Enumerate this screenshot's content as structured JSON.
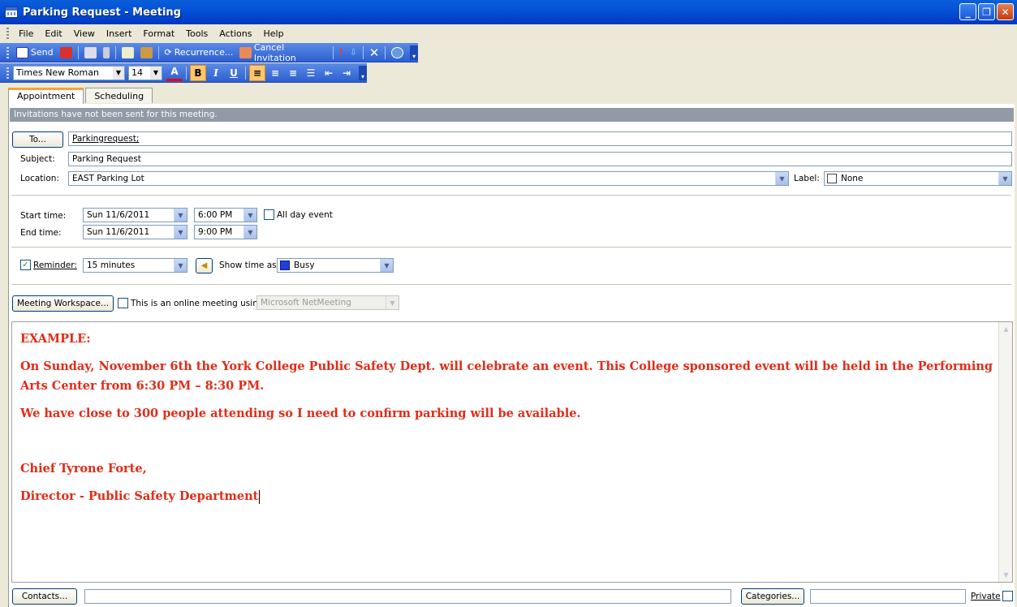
{
  "window": {
    "title": "Parking Request - Meeting"
  },
  "menu": [
    "File",
    "Edit",
    "View",
    "Insert",
    "Format",
    "Tools",
    "Actions",
    "Help"
  ],
  "toolbar": {
    "send": "Send",
    "recurrence": "Recurrence...",
    "cancel_invitation": "Cancel Invitation"
  },
  "format_bar": {
    "font": "Times New Roman",
    "size": "14",
    "bold": "B",
    "italic": "I",
    "underline": "U",
    "font_color": "A"
  },
  "tabs": [
    "Appointment",
    "Scheduling"
  ],
  "info_bar": "Invitations have not been sent for this meeting.",
  "form": {
    "to_button": "To...",
    "to_value": "Parkingrequest;",
    "subject_label": "Subject:",
    "subject_value": "Parking Request",
    "location_label": "Location:",
    "location_value": "EAST Parking Lot",
    "label_label": "Label:",
    "label_value": "None",
    "start_label": "Start time:",
    "start_date": "Sun 11/6/2011",
    "start_time": "6:00 PM",
    "all_day": "All day event",
    "end_label": "End time:",
    "end_date": "Sun 11/6/2011",
    "end_time": "9:00 PM",
    "reminder_label": "Reminder:",
    "reminder_value": "15 minutes",
    "show_time_label": "Show time as:",
    "show_time_value": "Busy",
    "workspace_button": "Meeting Workspace...",
    "online_label": "This is an online meeting using:",
    "online_value": "Microsoft NetMeeting"
  },
  "body": {
    "line1": "EXAMPLE:",
    "line2": "On Sunday, November 6th the York College Public Safety Dept. will celebrate an event.  This College sponsored event will be held in the Performing",
    "line3": "Arts Center from 6:30 PM – 8:30 PM.",
    "line4": "We have close to 300 people attending so I need to confirm parking will be available.",
    "line5": "Chief Tyrone Forte,",
    "line6": "Director - Public Safety Department"
  },
  "footer": {
    "contacts_button": "Contacts...",
    "categories_button": "Categories...",
    "private_label": "Private"
  },
  "colors": {
    "title_bar": "#0453d6",
    "body_text": "#e32b17",
    "busy": "#1f3fd8"
  }
}
